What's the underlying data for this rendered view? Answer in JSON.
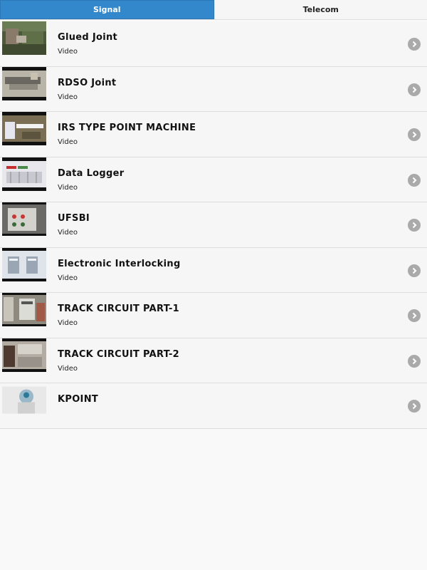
{
  "tabs": [
    {
      "label": "Signal",
      "active": true
    },
    {
      "label": "Telecom",
      "active": false
    }
  ],
  "items": [
    {
      "title": "Glued Joint",
      "subtitle": "Video",
      "icon": "chevron-right-icon"
    },
    {
      "title": "RDSO Joint",
      "subtitle": "Video",
      "icon": "chevron-right-icon"
    },
    {
      "title": "IRS TYPE POINT MACHINE",
      "subtitle": "Video",
      "icon": "chevron-right-icon"
    },
    {
      "title": "Data Logger",
      "subtitle": "Video",
      "icon": "chevron-right-icon"
    },
    {
      "title": "UFSBI",
      "subtitle": "Video",
      "icon": "chevron-right-icon"
    },
    {
      "title": "Electronic Interlocking",
      "subtitle": "Video",
      "icon": "chevron-right-icon"
    },
    {
      "title": "TRACK CIRCUIT PART-1",
      "subtitle": "Video",
      "icon": "chevron-right-icon"
    },
    {
      "title": "TRACK CIRCUIT PART-2",
      "subtitle": "Video",
      "icon": "chevron-right-icon"
    },
    {
      "title": "KPOINT",
      "subtitle": "",
      "icon": "chevron-right-icon"
    }
  ],
  "colors": {
    "active_tab": "#3388cc",
    "list_bg": "#f6f6f6",
    "chevron_bg": "#aaaaaa"
  }
}
